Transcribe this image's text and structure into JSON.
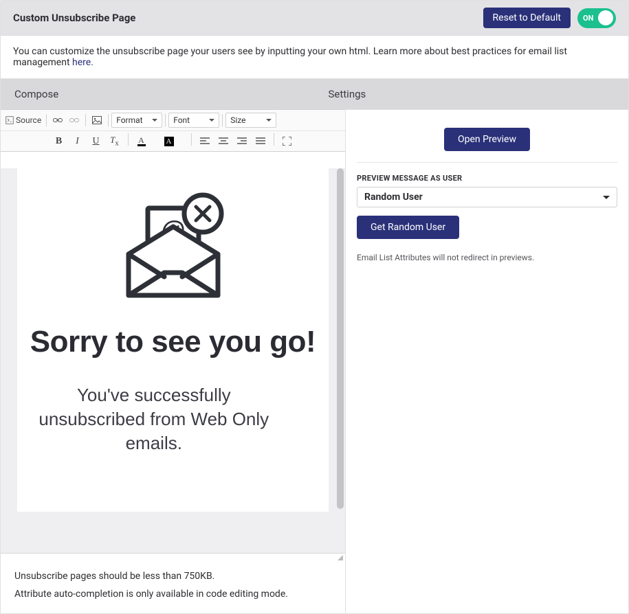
{
  "header": {
    "title": "Custom Unsubscribe Page",
    "reset_label": "Reset to Default",
    "toggle_label": "ON"
  },
  "info": {
    "text_prefix": "You can customize the unsubscribe page your users see by inputting your own html. Learn more about best practices for email list management ",
    "link_text": "here",
    "text_suffix": "."
  },
  "tabs": {
    "compose": "Compose",
    "settings": "Settings"
  },
  "toolbar": {
    "source": "Source",
    "format": "Format",
    "font": "Font",
    "size": "Size"
  },
  "editor": {
    "heading": "Sorry to see you go!",
    "body": "You've successfully unsubscribed from Web Only emails."
  },
  "notes": {
    "line1": "Unsubscribe pages should be less than 750KB.",
    "line2": "Attribute auto-completion is only available in code editing mode."
  },
  "settings_panel": {
    "open_preview": "Open Preview",
    "preview_label": "PREVIEW MESSAGE AS USER",
    "preview_selected": "Random User",
    "get_random": "Get Random User",
    "note": "Email List Attributes will not redirect in previews."
  }
}
